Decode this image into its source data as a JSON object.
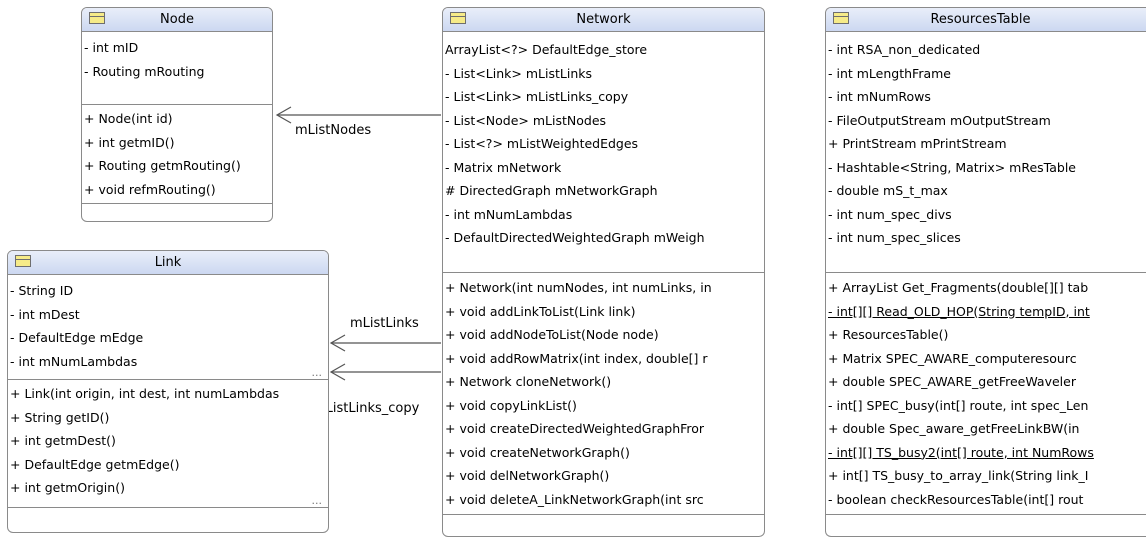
{
  "classes": {
    "node": {
      "name": "Node",
      "attributes": [
        "- int mID",
        "- Routing mRouting"
      ],
      "operations": [
        "+ Node(int id)",
        "+ int getmID()",
        "+ Routing getmRouting()",
        "+ void refmRouting()"
      ]
    },
    "link": {
      "name": "Link",
      "attributes": [
        "- String ID",
        "- int mDest",
        "- DefaultEdge mEdge",
        "- int mNumLambdas"
      ],
      "attributes_more": "...",
      "operations": [
        "+ Link(int origin, int dest, int numLambdas",
        "+ String getID()",
        "+ int getmDest()",
        "+ DefaultEdge getmEdge()",
        "+ int getmOrigin()"
      ],
      "operations_more": "..."
    },
    "network": {
      "name": "Network",
      "attributes": [
        " ArrayList<?> DefaultEdge_store",
        "- List<Link> mListLinks",
        "- List<Link> mListLinks_copy",
        "- List<Node> mListNodes",
        "- List<?> mListWeightedEdges",
        "- Matrix mNetwork",
        "# DirectedGraph mNetworkGraph",
        "- int mNumLambdas",
        "- DefaultDirectedWeightedGraph mWeigh"
      ],
      "operations": [
        "+ Network(int numNodes, int numLinks, in",
        "+ void addLinkToList(Link link)",
        "+ void addNodeToList(Node node)",
        "+ void addRowMatrix(int index, double[] r",
        "+ Network cloneNetwork()",
        "+ void copyLinkList()",
        "+ void createDirectedWeightedGraphFror",
        "+ void createNetworkGraph()",
        "+ void delNetworkGraph()",
        "+ void deleteA_LinkNetworkGraph(int src"
      ]
    },
    "resources": {
      "name": "ResourcesTable",
      "attributes": [
        "- int RSA_non_dedicated",
        "- int mLengthFrame",
        "- int mNumRows",
        "- FileOutputStream mOutputStream",
        "+ PrintStream mPrintStream",
        "- Hashtable<String, Matrix> mResTable",
        "- double mS_t_max",
        "- int num_spec_divs",
        "- int num_spec_slices"
      ],
      "operations": [
        "+ ArrayList Get_Fragments(double[][] tab",
        "- int[][] Read_OLD_HOP(String tempID, int",
        "+ ResourcesTable()",
        "+ Matrix SPEC_AWARE_computeresourc",
        "+ double SPEC_AWARE_getFreeWaveler",
        "- int[] SPEC_busy(int[] route, int spec_Len",
        "+ double Spec_aware_getFreeLinkBW(in",
        "- int[][] TS_busy2(int[] route, int NumRows",
        "+ int[] TS_busy_to_array_link(String link_I",
        "- boolean checkResourcesTable(int[] rout"
      ],
      "underlined_operations": [
        1,
        7
      ]
    }
  },
  "associations": {
    "nodes_label": "mListNodes",
    "links_label": "mListLinks",
    "links_copy_label": "mListLinks_copy"
  },
  "colors": {
    "header_gradient_top": "#e9eef9",
    "header_gradient_bottom": "#ccd8f1",
    "class_icon_fill": "#f6eb88",
    "border": "#8a8a8a"
  }
}
